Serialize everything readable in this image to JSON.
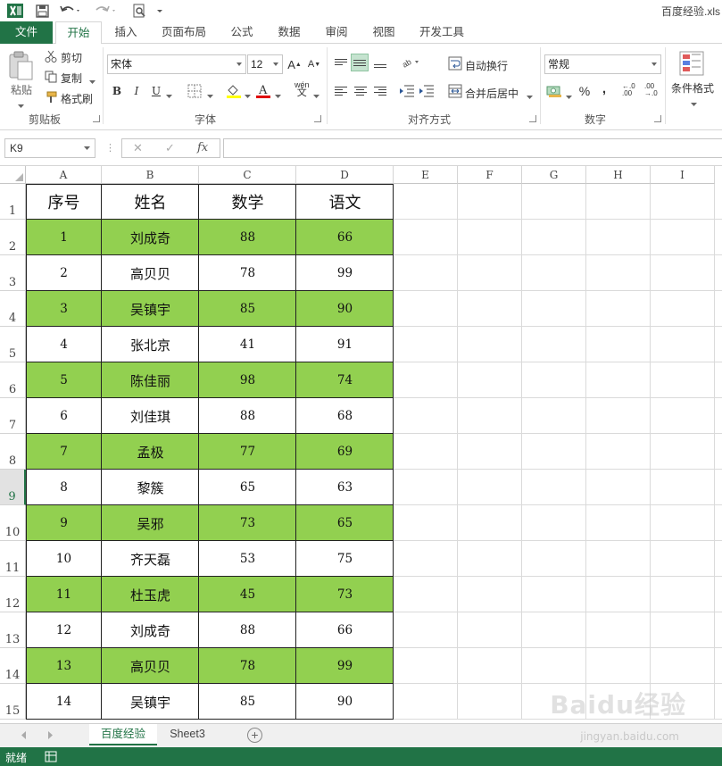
{
  "title_bar": {
    "doc_title": "百度经验.xls"
  },
  "ribbon": {
    "tabs": [
      "文件",
      "开始",
      "插入",
      "页面布局",
      "公式",
      "数据",
      "审阅",
      "视图",
      "开发工具"
    ],
    "active_tab": "开始",
    "clipboard": {
      "paste": "粘贴",
      "cut": "剪切",
      "copy": "复制",
      "format_painter": "格式刷",
      "group": "剪贴板"
    },
    "font": {
      "name": "宋体",
      "size": "12",
      "bold": "B",
      "italic": "I",
      "underline": "U",
      "phonetic": "wén",
      "group": "字体"
    },
    "alignment": {
      "wrap_text": "自动换行",
      "merge_center": "合并后居中",
      "group": "对齐方式"
    },
    "number": {
      "format": "常规",
      "percent": "%",
      "comma": ",",
      "group": "数字"
    },
    "styles": {
      "conditional_format": "条件格式"
    }
  },
  "formula_bar": {
    "name_box": "K9",
    "cancel": "✕",
    "enter": "✓",
    "fx": "fx",
    "value": ""
  },
  "grid": {
    "column_headers": [
      "A",
      "B",
      "C",
      "D",
      "E",
      "F",
      "G",
      "H",
      "I"
    ],
    "row_headers": [
      "1",
      "2",
      "3",
      "4",
      "5",
      "6",
      "7",
      "8",
      "9",
      "10",
      "11",
      "12",
      "13",
      "14",
      "15"
    ],
    "active_row": "9",
    "highlight_color": "#92d050",
    "table": {
      "headers": [
        "序号",
        "姓名",
        "数学",
        "语文"
      ],
      "rows": [
        [
          "1",
          "刘成奇",
          "88",
          "66"
        ],
        [
          "2",
          "高贝贝",
          "78",
          "99"
        ],
        [
          "3",
          "吴镇宇",
          "85",
          "90"
        ],
        [
          "4",
          "张北京",
          "41",
          "91"
        ],
        [
          "5",
          "陈佳丽",
          "98",
          "74"
        ],
        [
          "6",
          "刘佳琪",
          "88",
          "68"
        ],
        [
          "7",
          "孟极",
          "77",
          "69"
        ],
        [
          "8",
          "黎簇",
          "65",
          "63"
        ],
        [
          "9",
          "吴邪",
          "73",
          "65"
        ],
        [
          "10",
          "齐天磊",
          "53",
          "75"
        ],
        [
          "11",
          "杜玉虎",
          "45",
          "73"
        ],
        [
          "12",
          "刘成奇",
          "88",
          "66"
        ],
        [
          "13",
          "高贝贝",
          "78",
          "99"
        ],
        [
          "14",
          "吴镇宇",
          "85",
          "90"
        ]
      ]
    }
  },
  "sheet_tabs": {
    "tabs": [
      "百度经验",
      "Sheet3"
    ],
    "active": "百度经验",
    "add": "+"
  },
  "status_bar": {
    "text": "就绪"
  },
  "watermark": {
    "text": "Baidu经验",
    "sub": "jingyan.baidu.com"
  },
  "colors": {
    "accent": "#217346",
    "row_highlight": "#92d050"
  }
}
